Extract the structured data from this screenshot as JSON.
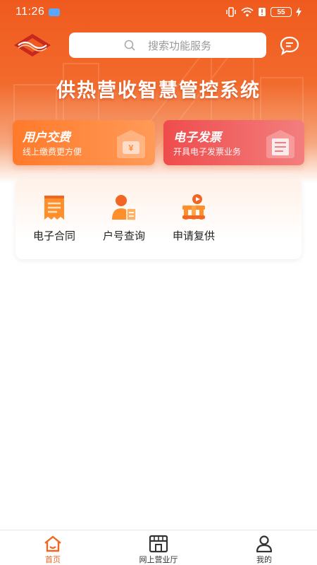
{
  "status_bar": {
    "time": "11:26",
    "battery": "55"
  },
  "header": {
    "search_placeholder": "搜索功能服务"
  },
  "hero": {
    "title": "供热营收智慧管控系统"
  },
  "cards": [
    {
      "title": "用户交费",
      "subtitle": "线上缴费更方便",
      "icon": "yuan-wallet-icon"
    },
    {
      "title": "电子发票",
      "subtitle": "开具电子发票业务",
      "icon": "receipt-icon"
    }
  ],
  "services": [
    {
      "label": "电子合同",
      "icon": "contract-icon"
    },
    {
      "label": "户号查询",
      "icon": "account-query-icon"
    },
    {
      "label": "申请复供",
      "icon": "resume-supply-icon"
    }
  ],
  "tabbar": {
    "items": [
      {
        "label": "首页",
        "icon": "home-icon",
        "active": true
      },
      {
        "label": "网上营业厅",
        "icon": "store-icon",
        "active": false
      },
      {
        "label": "我的",
        "icon": "user-icon",
        "active": false
      }
    ]
  },
  "colors": {
    "brand_orange": "#f26522",
    "hero_red": "#f05a1e",
    "invoice_red": "#ef4c4c"
  }
}
